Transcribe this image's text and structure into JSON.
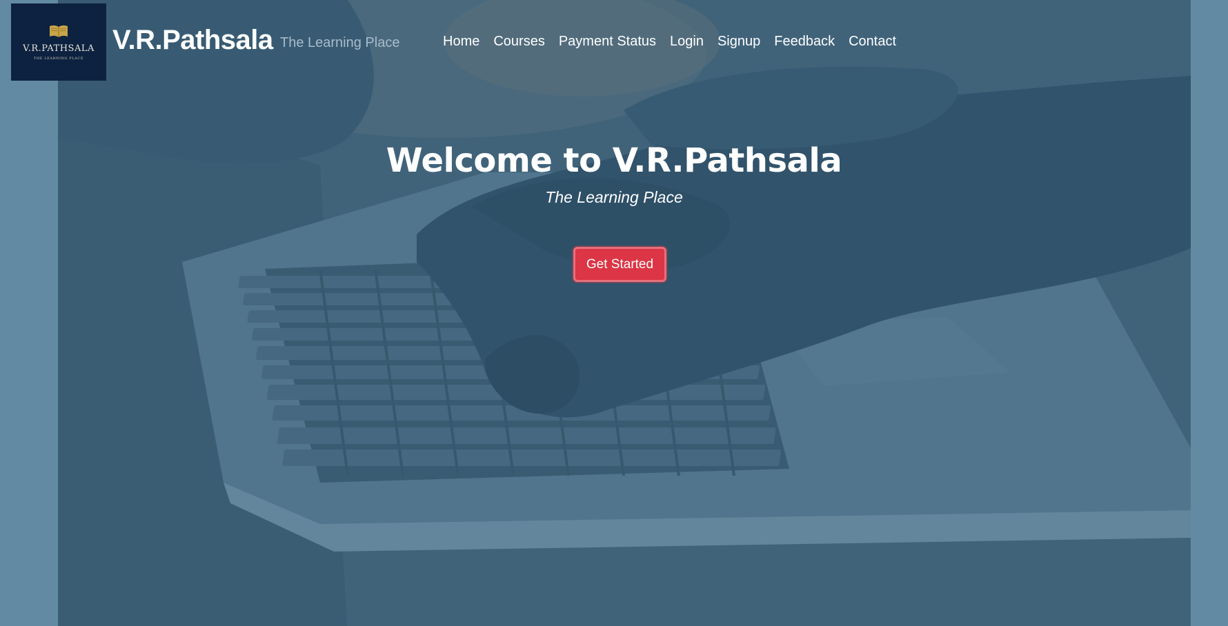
{
  "logo": {
    "name": "V.R.PATHSALA",
    "tagline": "THE LEARNING PLACE"
  },
  "header": {
    "brand": "V.R.Pathsala",
    "tagline": "The Learning Place"
  },
  "nav": {
    "items": [
      {
        "label": "Home"
      },
      {
        "label": "Courses"
      },
      {
        "label": "Payment Status"
      },
      {
        "label": "Login"
      },
      {
        "label": "Signup"
      },
      {
        "label": "Feedback"
      },
      {
        "label": "Contact"
      }
    ]
  },
  "hero": {
    "title": "Welcome to V.R.Pathsala",
    "subtitle": "The Learning Place",
    "cta_label": "Get Started"
  },
  "colors": {
    "page_bg": "#628aa3",
    "hero_bg": "#4a6f88",
    "logo_bg": "#0d2240",
    "cta": "#dc3545",
    "brand_text": "#ffffff",
    "tagline_text": "#a8bccb"
  }
}
